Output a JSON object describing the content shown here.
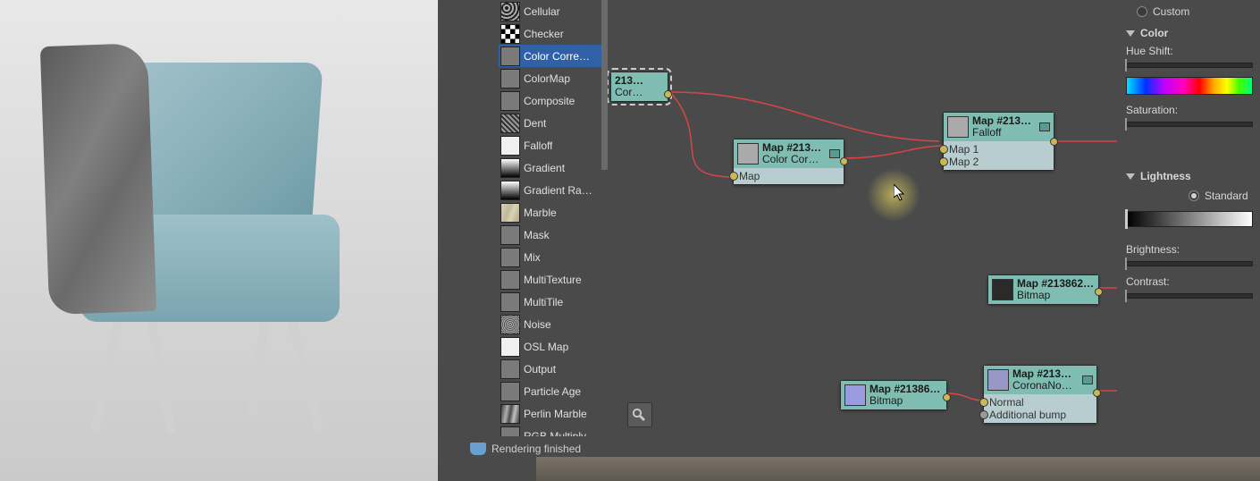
{
  "custom_radio_label": "Custom",
  "color_section": "Color",
  "hue_shift_label": "Hue Shift:",
  "saturation_label": "Saturation:",
  "lightness_section": "Lightness",
  "standard_radio_label": "Standard",
  "brightness_label": "Brightness:",
  "contrast_label": "Contrast:",
  "status_text": "Rendering finished",
  "map_list": [
    {
      "label": "Cellular",
      "swatch": "sw-cellular"
    },
    {
      "label": "Checker",
      "swatch": "sw-checker"
    },
    {
      "label": "Color Corre…",
      "swatch": "sw-grey",
      "selected": true
    },
    {
      "label": "ColorMap",
      "swatch": "sw-grey"
    },
    {
      "label": "Composite",
      "swatch": "sw-grey"
    },
    {
      "label": "Dent",
      "swatch": "sw-dent"
    },
    {
      "label": "Falloff",
      "swatch": "sw-white"
    },
    {
      "label": "Gradient",
      "swatch": "sw-gradient"
    },
    {
      "label": "Gradient Ra…",
      "swatch": "sw-gradient"
    },
    {
      "label": "Marble",
      "swatch": "sw-marble"
    },
    {
      "label": "Mask",
      "swatch": "sw-grey"
    },
    {
      "label": "Mix",
      "swatch": "sw-grey"
    },
    {
      "label": "MultiTexture",
      "swatch": "sw-grey"
    },
    {
      "label": "MultiTile",
      "swatch": "sw-grey"
    },
    {
      "label": "Noise",
      "swatch": "sw-noise"
    },
    {
      "label": "OSL Map",
      "swatch": "sw-white"
    },
    {
      "label": "Output",
      "swatch": "sw-grey"
    },
    {
      "label": "Particle Age",
      "swatch": "sw-grey"
    },
    {
      "label": "Perlin Marble",
      "swatch": "sw-perlin"
    },
    {
      "label": "RGB Multiply",
      "swatch": "sw-grey"
    }
  ],
  "nodes": {
    "n1": {
      "title": "213…",
      "sub": "Cor…"
    },
    "n2": {
      "title": "Map #213…",
      "sub": "Color Cor…",
      "slot1": "Map"
    },
    "n3": {
      "title": "Map #213…",
      "sub": "Falloff",
      "slot1": "Map 1",
      "slot2": "Map 2"
    },
    "n4": {
      "title": "Map #213862…",
      "sub": "Bitmap"
    },
    "n5": {
      "title": "Map #213862…",
      "sub": "Bitmap"
    },
    "n6": {
      "title": "Map #213…",
      "sub": "CoronaNo…",
      "slot1": "Normal",
      "slot2": "Additional bump"
    }
  }
}
